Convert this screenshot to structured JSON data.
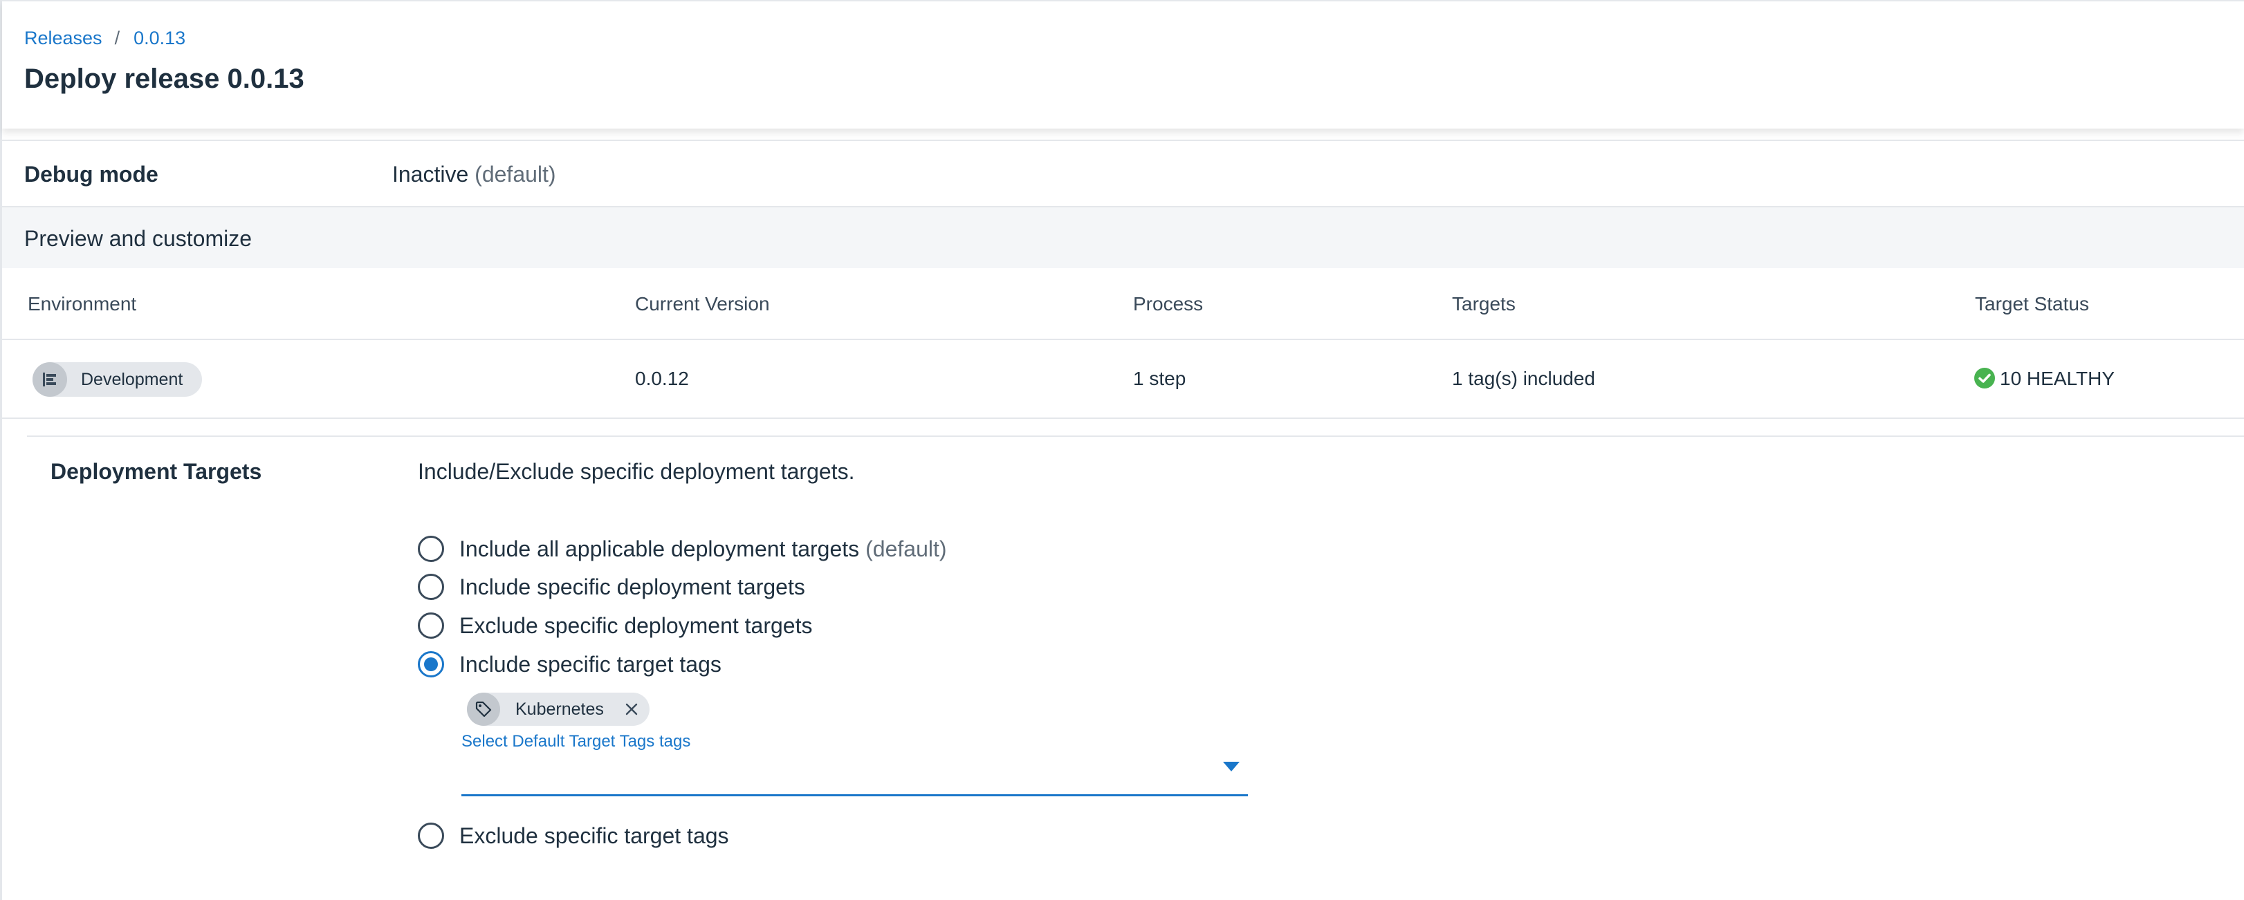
{
  "breadcrumb": {
    "items": [
      "Releases",
      "0.0.13"
    ],
    "separator": "/"
  },
  "page": {
    "title": "Deploy release 0.0.13"
  },
  "debug_mode": {
    "label": "Debug mode",
    "value": "Inactive",
    "note": "(default)"
  },
  "preview": {
    "title": "Preview and customize"
  },
  "table": {
    "headers": [
      "Environment",
      "Current Version",
      "Process",
      "Targets",
      "Target Status"
    ],
    "rows": [
      {
        "environment": "Development",
        "environment_icon": "environment-icon",
        "current_version": "0.0.12",
        "process": "1 step",
        "targets": "1 tag(s) included",
        "target_status": "10 HEALTHY",
        "target_status_icon": "check-circle-icon"
      }
    ]
  },
  "deployment_targets": {
    "label": "Deployment Targets",
    "description": "Include/Exclude specific deployment targets.",
    "options": [
      {
        "label": "Include all applicable deployment targets",
        "note": "(default)",
        "checked": false
      },
      {
        "label": "Include specific deployment targets",
        "note": "",
        "checked": false
      },
      {
        "label": "Exclude specific deployment targets",
        "note": "",
        "checked": false
      },
      {
        "label": "Include specific target tags",
        "note": "",
        "checked": true
      },
      {
        "label": "Exclude specific target tags",
        "note": "",
        "checked": false
      }
    ],
    "selected_tags": [
      {
        "label": "Kubernetes",
        "icon": "tag-icon"
      }
    ],
    "select_label": "Select Default Target Tags tags"
  },
  "colors": {
    "accent": "#1a77ca",
    "healthy": "#48b350",
    "text": "#1f303f",
    "muted": "#606c78",
    "section_bg": "#f4f6f8",
    "border": "#e4e7eb"
  }
}
